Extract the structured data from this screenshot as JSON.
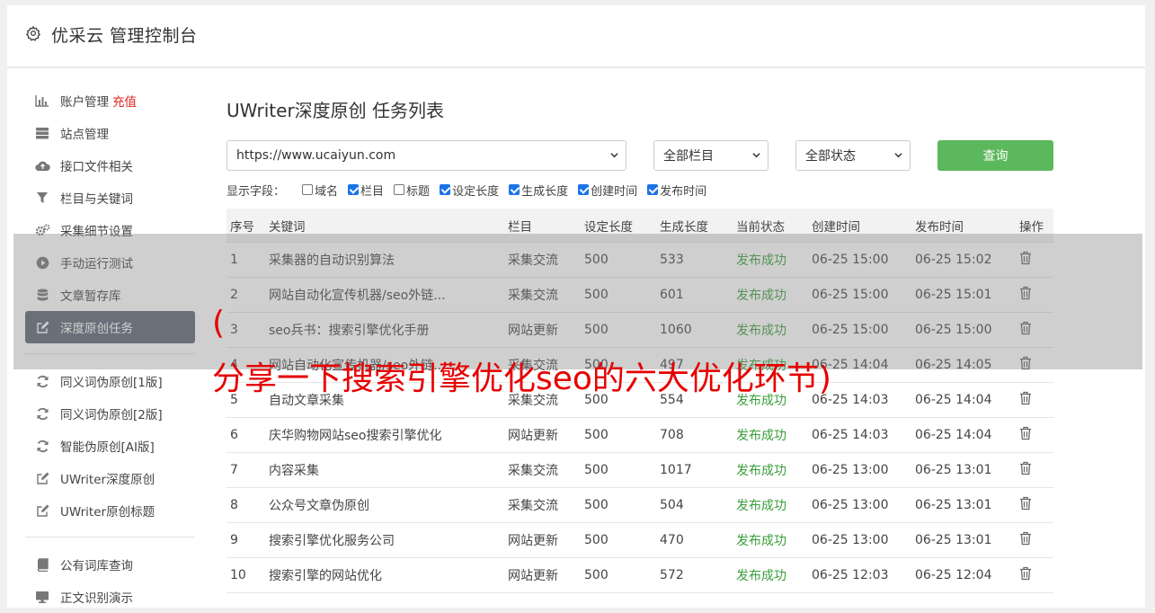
{
  "header": {
    "title": "优采云 管理控制台",
    "icon": "gear-icon"
  },
  "sidebar": {
    "group1": [
      {
        "label": "账户管理",
        "extra": "充值",
        "icon": "bar-chart-icon"
      },
      {
        "label": "站点管理",
        "icon": "server-icon"
      },
      {
        "label": "接口文件相关",
        "icon": "cloud-upload-icon"
      },
      {
        "label": "栏目与关键词",
        "icon": "filter-icon"
      },
      {
        "label": "采集细节设置",
        "icon": "cogs-icon"
      },
      {
        "label": "手动运行测试",
        "icon": "play-circle-icon"
      },
      {
        "label": "文章暂存库",
        "icon": "database-icon"
      },
      {
        "label": "深度原创任务",
        "icon": "edit-icon"
      }
    ],
    "group2": [
      {
        "label": "同义词伪原创[1版]",
        "icon": "refresh-icon"
      },
      {
        "label": "同义词伪原创[2版]",
        "icon": "refresh-icon"
      },
      {
        "label": "智能伪原创[AI版]",
        "icon": "refresh-icon"
      },
      {
        "label": "UWriter深度原创",
        "icon": "edit-icon"
      },
      {
        "label": "UWriter原创标题",
        "icon": "edit-icon"
      }
    ],
    "group3": [
      {
        "label": "公有词库查询",
        "icon": "book-icon"
      },
      {
        "label": "正文识别演示",
        "icon": "monitor-icon"
      }
    ]
  },
  "page": {
    "title": "UWriter深度原创 任务列表"
  },
  "filters": {
    "site": "https://www.ucaiyun.com",
    "column": "全部栏目",
    "status": "全部状态",
    "query_label": "查询"
  },
  "fields": {
    "label": "显示字段：",
    "options": [
      {
        "label": "域名",
        "checked": false
      },
      {
        "label": "栏目",
        "checked": true
      },
      {
        "label": "标题",
        "checked": false
      },
      {
        "label": "设定长度",
        "checked": true
      },
      {
        "label": "生成长度",
        "checked": true
      },
      {
        "label": "创建时间",
        "checked": true
      },
      {
        "label": "发布时间",
        "checked": true
      }
    ]
  },
  "table": {
    "headers": [
      "序号",
      "关键词",
      "栏目",
      "设定长度",
      "生成长度",
      "当前状态",
      "创建时间",
      "发布时间",
      "操作"
    ],
    "rows": [
      [
        "1",
        "采集器的自动识别算法",
        "采集交流",
        "500",
        "533",
        "发布成功",
        "06-25 15:00",
        "06-25 15:02"
      ],
      [
        "2",
        "网站自动化宣传机器/seo外链...",
        "采集交流",
        "500",
        "601",
        "发布成功",
        "06-25 15:00",
        "06-25 15:01"
      ],
      [
        "3",
        "seo兵书：搜索引擎优化手册",
        "网站更新",
        "500",
        "1060",
        "发布成功",
        "06-25 15:00",
        "06-25 15:00"
      ],
      [
        "4",
        "网站自动化宣传机器/seo外链...",
        "采集交流",
        "500",
        "497",
        "发布成功",
        "06-25 14:04",
        "06-25 14:05"
      ],
      [
        "5",
        "自动文章采集",
        "采集交流",
        "500",
        "554",
        "发布成功",
        "06-25 14:03",
        "06-25 14:04"
      ],
      [
        "6",
        "庆华购物网站seo搜索引擎优化",
        "网站更新",
        "500",
        "708",
        "发布成功",
        "06-25 14:03",
        "06-25 14:04"
      ],
      [
        "7",
        "内容采集",
        "采集交流",
        "500",
        "1017",
        "发布成功",
        "06-25 13:00",
        "06-25 13:01"
      ],
      [
        "8",
        "公众号文章伪原创",
        "采集交流",
        "500",
        "504",
        "发布成功",
        "06-25 13:00",
        "06-25 13:01"
      ],
      [
        "9",
        "搜索引擎优化服务公司",
        "网站更新",
        "500",
        "470",
        "发布成功",
        "06-25 13:00",
        "06-25 13:01"
      ],
      [
        "10",
        "搜索引擎的网站优化",
        "网站更新",
        "500",
        "572",
        "发布成功",
        "06-25 12:03",
        "06-25 12:04"
      ]
    ]
  },
  "overlay": {
    "line1": "(",
    "line2": "分享一下搜索引擎优化seo的六大优化环节)"
  }
}
